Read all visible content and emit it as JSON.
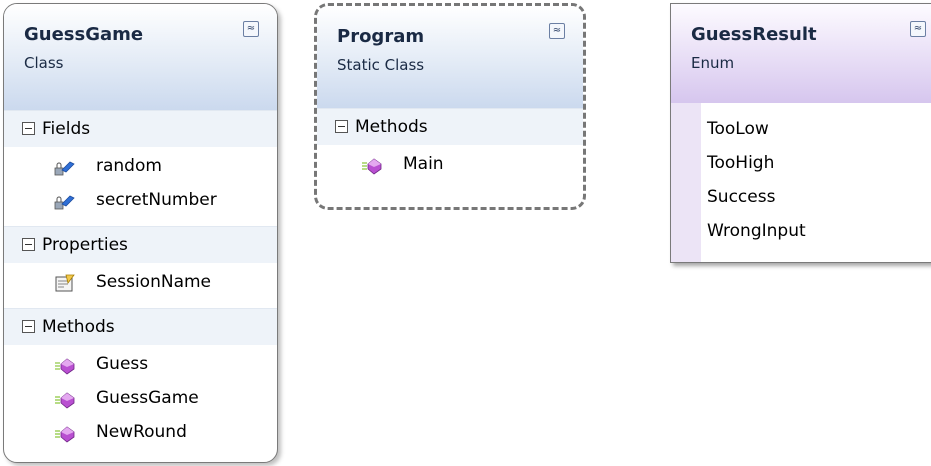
{
  "guessgame": {
    "title": "GuessGame",
    "subtitle": "Class",
    "collapse_glyph": "≈",
    "sections": [
      {
        "label": "Fields",
        "members": [
          {
            "name": "random",
            "icon": "field-lock-icon"
          },
          {
            "name": "secretNumber",
            "icon": "field-lock-icon"
          }
        ]
      },
      {
        "label": "Properties",
        "members": [
          {
            "name": "SessionName",
            "icon": "property-icon"
          }
        ]
      },
      {
        "label": "Methods",
        "members": [
          {
            "name": "Guess",
            "icon": "method-icon"
          },
          {
            "name": "GuessGame",
            "icon": "method-icon"
          },
          {
            "name": "NewRound",
            "icon": "method-icon"
          }
        ]
      }
    ]
  },
  "program": {
    "title": "Program",
    "subtitle": "Static Class",
    "collapse_glyph": "≈",
    "sections": [
      {
        "label": "Methods",
        "members": [
          {
            "name": "Main",
            "icon": "method-icon"
          }
        ]
      }
    ]
  },
  "guessresult": {
    "title": "GuessResult",
    "subtitle": "Enum",
    "collapse_glyph": "≈",
    "values": [
      "TooLow",
      "TooHigh",
      "Success",
      "WrongInput"
    ]
  },
  "colors": {
    "class_header": "#cbd9ee",
    "enum_header": "#d6c6ee",
    "method_icon": "#b94fd1",
    "field_icon": "#2f6fd6"
  }
}
